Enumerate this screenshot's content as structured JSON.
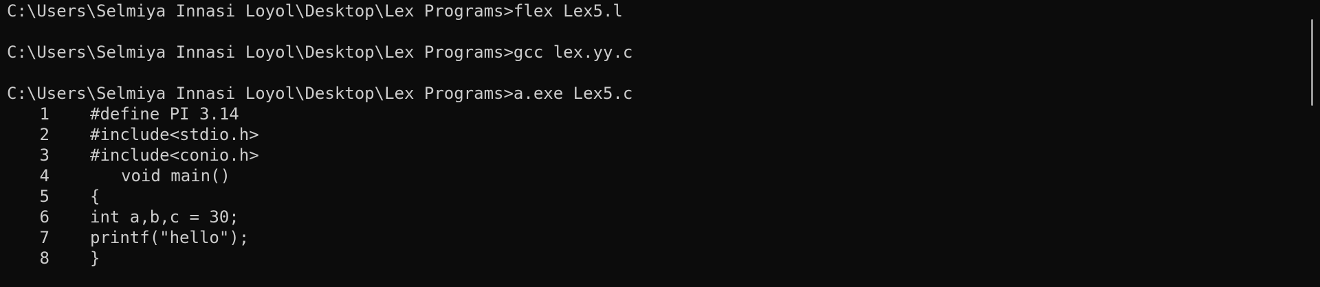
{
  "terminal": {
    "commands": [
      {
        "prompt": "C:\\Users\\Selmiya Innasi Loyol\\Desktop\\Lex Programs>",
        "command": "flex Lex5.l"
      },
      {
        "prompt": "C:\\Users\\Selmiya Innasi Loyol\\Desktop\\Lex Programs>",
        "command": "gcc lex.yy.c"
      },
      {
        "prompt": "C:\\Users\\Selmiya Innasi Loyol\\Desktop\\Lex Programs>",
        "command": "a.exe Lex5.c"
      }
    ],
    "output_lines": [
      {
        "number": "1",
        "text": "#define PI 3.14"
      },
      {
        "number": "2",
        "text": "#include<stdio.h>"
      },
      {
        "number": "3",
        "text": "#include<conio.h>"
      },
      {
        "number": "4",
        "text": "void main()"
      },
      {
        "number": "5",
        "text": "{"
      },
      {
        "number": "6",
        "text": "int a,b,c = 30;"
      },
      {
        "number": "7",
        "text": "printf(\"hello\");"
      },
      {
        "number": "8",
        "text": "}"
      }
    ]
  },
  "colors": {
    "background": "#0c0c0c",
    "foreground": "#cccccc",
    "scrollbar": "#9a9a9a"
  }
}
